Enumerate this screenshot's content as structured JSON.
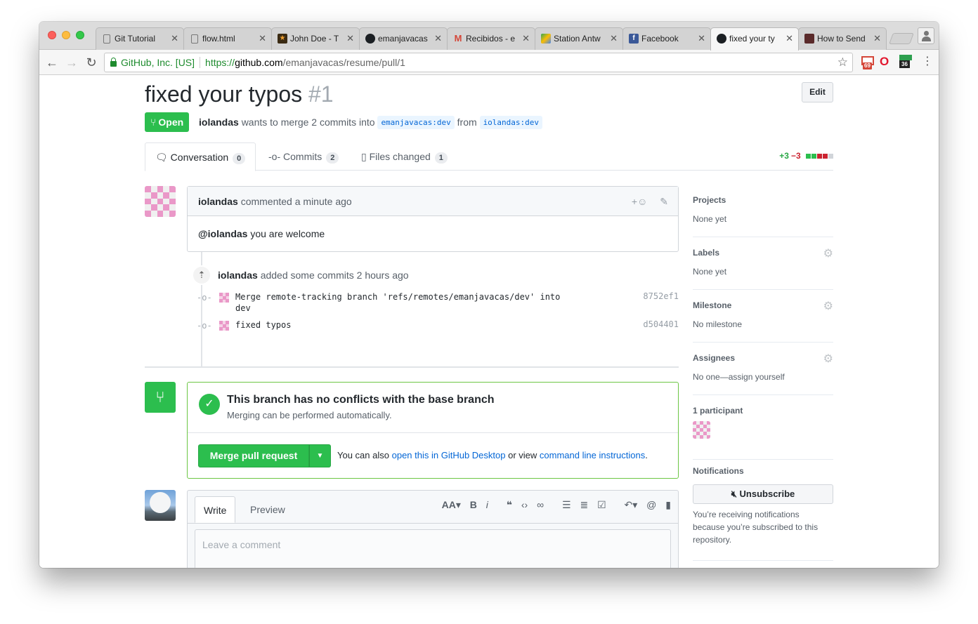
{
  "browser": {
    "tabs": [
      {
        "title": "Git Tutorial",
        "icon": "page-icon"
      },
      {
        "title": "flow.html",
        "icon": "page-icon"
      },
      {
        "title": "John Doe - T",
        "icon": "star-icon"
      },
      {
        "title": "emanjavacas",
        "icon": "github-icon"
      },
      {
        "title": "Recibidos - e",
        "icon": "gmail-icon"
      },
      {
        "title": "Station Antw",
        "icon": "maps-icon"
      },
      {
        "title": "Facebook",
        "icon": "facebook-icon"
      },
      {
        "title": "fixed your ty",
        "icon": "github-icon"
      },
      {
        "title": "How to Send",
        "icon": "page-icon"
      }
    ],
    "active_tab_index": 7,
    "security_label": "GitHub, Inc. [US]",
    "url_scheme": "https://",
    "url_host": "github.com",
    "url_path": "/emanjavacas/resume/pull/1",
    "gmail_badge": "69",
    "calendar_badge": "36"
  },
  "pr": {
    "title": "fixed your typos",
    "number": "#1",
    "edit_label": "Edit",
    "state": "Open",
    "author": "iolandas",
    "merge_text": "wants to merge 2 commits into",
    "base_branch": "emanjavacas:dev",
    "from_text": "from",
    "head_branch": "iolandas:dev"
  },
  "tabs": [
    {
      "label": "Conversation",
      "count": "0"
    },
    {
      "label": "Commits",
      "count": "2"
    },
    {
      "label": "Files changed",
      "count": "1"
    }
  ],
  "diffstat": {
    "additions": "+3",
    "deletions": "−3"
  },
  "comment": {
    "author": "iolandas",
    "action": "commented",
    "time": "a minute ago",
    "mention": "@iolandas",
    "body": "you are welcome"
  },
  "commits_event": {
    "author": "iolandas",
    "action": "added some commits",
    "time": "2 hours ago",
    "commits": [
      {
        "message": "Merge remote-tracking branch 'refs/remotes/emanjavacas/dev' into dev",
        "sha": "8752ef1"
      },
      {
        "message": "fixed typos",
        "sha": "d504401"
      }
    ]
  },
  "merge": {
    "title": "This branch has no conflicts with the base branch",
    "subtitle": "Merging can be performed automatically.",
    "button": "Merge pull request",
    "alt_prefix": "You can also",
    "alt_link1": "open this in GitHub Desktop",
    "alt_middle": "or view",
    "alt_link2": "command line instructions",
    "alt_suffix": "."
  },
  "composer": {
    "write_tab": "Write",
    "preview_tab": "Preview",
    "placeholder": "Leave a comment",
    "toolbar_icons": [
      "text-size-icon",
      "bold-icon",
      "italic-icon",
      "quote-icon",
      "code-icon",
      "link-icon",
      "bullet-list-icon",
      "numbered-list-icon",
      "task-list-icon",
      "reply-icon",
      "mention-icon",
      "bookmark-icon"
    ]
  },
  "sidebar": {
    "projects": {
      "heading": "Projects",
      "value": "None yet"
    },
    "labels": {
      "heading": "Labels",
      "value": "None yet"
    },
    "milestone": {
      "heading": "Milestone",
      "value": "No milestone"
    },
    "assignees": {
      "heading": "Assignees",
      "value": "No one—assign yourself"
    },
    "participants": {
      "heading": "1 participant"
    },
    "notifications": {
      "heading": "Notifications",
      "button": "Unsubscribe",
      "text": "You’re receiving notifications because you’re subscribed to this repository."
    }
  },
  "colors": {
    "open_green": "#2cbe4e",
    "link_blue": "#0366d6",
    "identicon_pink": "#ea98c8",
    "diff_red": "#cb2431"
  }
}
